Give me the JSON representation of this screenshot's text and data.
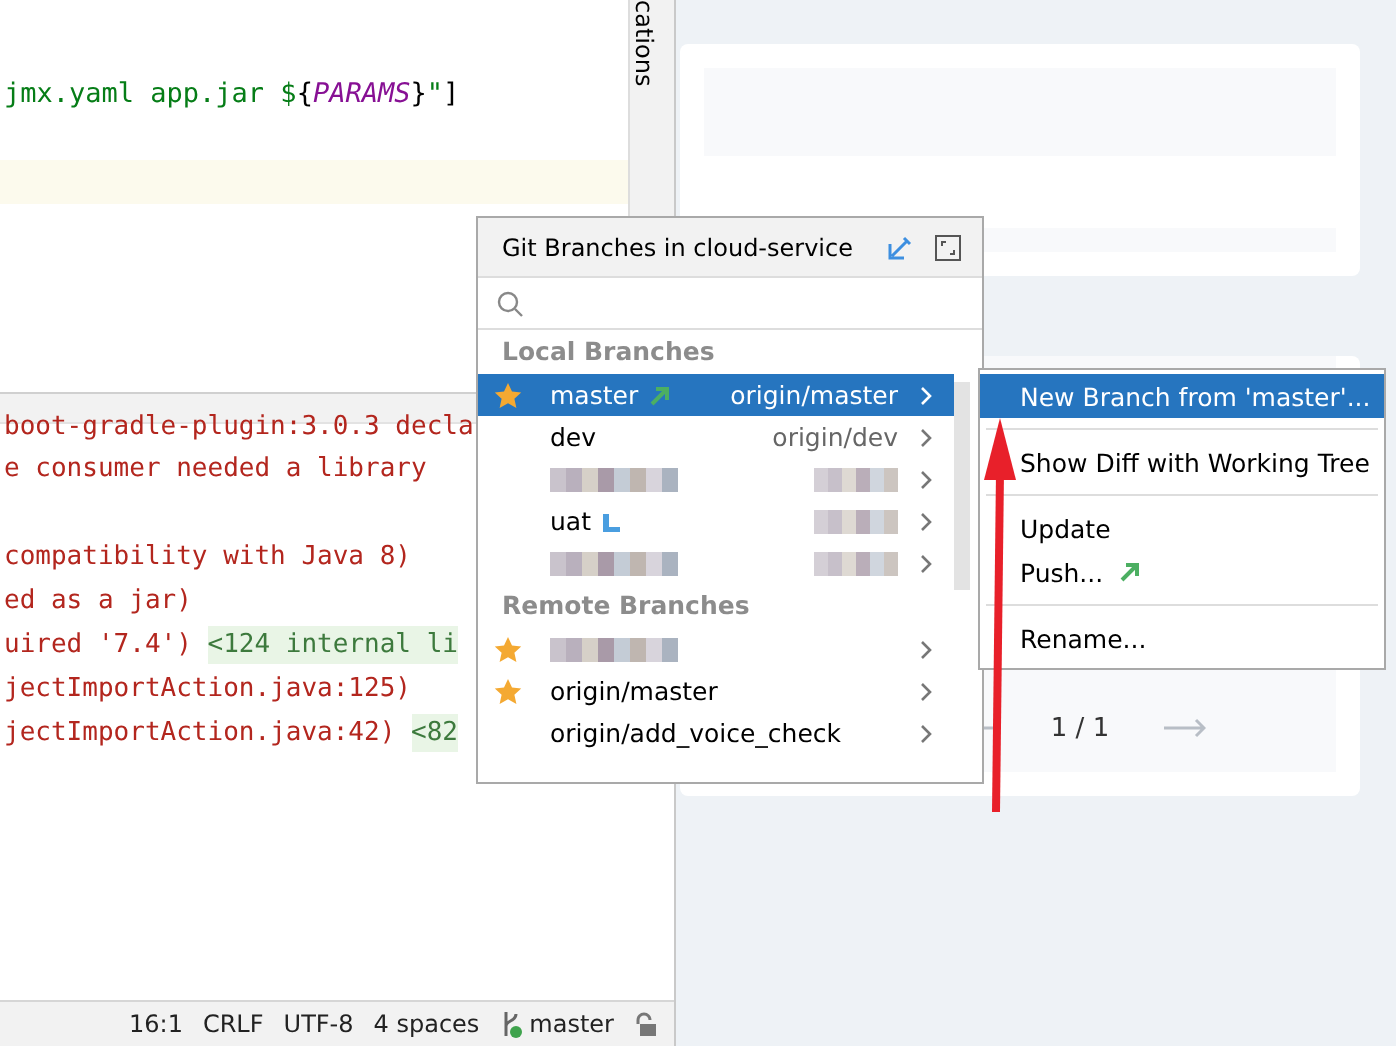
{
  "editor": {
    "current_line_highlighted": true,
    "code_line": [
      {
        "kind": "string",
        "text": "jmx.yaml app.jar $"
      },
      {
        "kind": "brace",
        "text": "{"
      },
      {
        "kind": "param",
        "text": "PARAMS"
      },
      {
        "kind": "brace",
        "text": "}"
      },
      {
        "kind": "string",
        "text": "\""
      },
      {
        "kind": "plain",
        "text": "]"
      }
    ]
  },
  "tool_strip": {
    "label": "cations"
  },
  "console": {
    "lines": [
      {
        "kind": "text",
        "text": "boot-gradle-plugin:3.0.3 decla"
      },
      {
        "kind": "text",
        "text": "e consumer needed a library"
      },
      {
        "kind": "blank"
      },
      {
        "kind": "text",
        "text": "compatibility with Java 8)"
      },
      {
        "kind": "text",
        "text": "ed as a jar)"
      },
      {
        "kind": "text",
        "text": "uired '7.4') ",
        "link": "<124 internal li"
      },
      {
        "kind": "text",
        "text": "jectImportAction.java:125)"
      },
      {
        "kind": "text",
        "text": "jectImportAction.java:42) ",
        "link": "<82"
      }
    ]
  },
  "status_bar": {
    "position": "16:1",
    "line_separator": "CRLF",
    "encoding": "UTF-8",
    "indent": "4 spaces",
    "branch": "master"
  },
  "right_panel": {
    "pager": "1 / 1"
  },
  "branches_popup": {
    "title": "Git Branches in cloud-service",
    "sections": [
      {
        "title": "Local Branches",
        "items": [
          {
            "kind": "branch",
            "name": "master",
            "starred": true,
            "selected": true,
            "outgoing": true,
            "incoming": false,
            "tracking": "origin/master",
            "tracking_blurred": false
          },
          {
            "kind": "branch",
            "name": "dev",
            "starred": false,
            "selected": false,
            "outgoing": false,
            "incoming": false,
            "tracking": "origin/dev",
            "tracking_blurred": false
          },
          {
            "kind": "redacted",
            "starred": false,
            "selected": false,
            "outgoing": false,
            "incoming": false,
            "tracking_blurred": true
          },
          {
            "kind": "branch",
            "name": "uat",
            "starred": false,
            "selected": false,
            "outgoing": false,
            "incoming": true,
            "tracking_blurred": true
          },
          {
            "kind": "redacted",
            "starred": false,
            "selected": false,
            "outgoing": false,
            "incoming": false,
            "tracking_blurred": true
          }
        ]
      },
      {
        "title": "Remote Branches",
        "items": [
          {
            "kind": "redacted",
            "starred": true,
            "selected": false,
            "outgoing": false,
            "incoming": false,
            "tracking_blurred": false
          },
          {
            "kind": "branch",
            "name": "origin/master",
            "starred": true,
            "selected": false,
            "outgoing": false,
            "incoming": false,
            "tracking_blurred": false
          },
          {
            "kind": "branch",
            "name": "origin/add_voice_check",
            "starred": false,
            "selected": false,
            "outgoing": false,
            "incoming": false,
            "tracking_blurred": false
          }
        ]
      }
    ]
  },
  "branch_menu": {
    "groups": [
      [
        {
          "label": "New Branch from 'master'...",
          "selected": true,
          "outgoing": false
        }
      ],
      [
        {
          "label": "Show Diff with Working Tree",
          "selected": false,
          "outgoing": false
        }
      ],
      [
        {
          "label": "Update",
          "selected": false,
          "outgoing": false
        },
        {
          "label": "Push...",
          "selected": false,
          "outgoing": true
        }
      ],
      [
        {
          "label": "Rename...",
          "selected": false,
          "outgoing": false
        }
      ]
    ]
  }
}
